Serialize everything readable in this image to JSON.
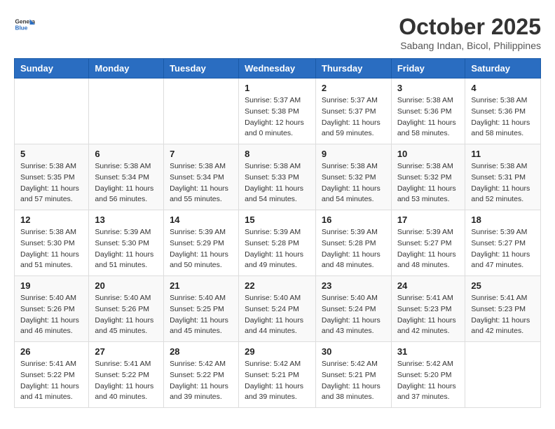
{
  "header": {
    "logo": "GeneralBlue",
    "month": "October 2025",
    "location": "Sabang Indan, Bicol, Philippines"
  },
  "weekdays": [
    "Sunday",
    "Monday",
    "Tuesday",
    "Wednesday",
    "Thursday",
    "Friday",
    "Saturday"
  ],
  "weeks": [
    [
      {
        "day": "",
        "info": ""
      },
      {
        "day": "",
        "info": ""
      },
      {
        "day": "",
        "info": ""
      },
      {
        "day": "1",
        "info": "Sunrise: 5:37 AM\nSunset: 5:38 PM\nDaylight: 12 hours\nand 0 minutes."
      },
      {
        "day": "2",
        "info": "Sunrise: 5:37 AM\nSunset: 5:37 PM\nDaylight: 11 hours\nand 59 minutes."
      },
      {
        "day": "3",
        "info": "Sunrise: 5:38 AM\nSunset: 5:36 PM\nDaylight: 11 hours\nand 58 minutes."
      },
      {
        "day": "4",
        "info": "Sunrise: 5:38 AM\nSunset: 5:36 PM\nDaylight: 11 hours\nand 58 minutes."
      }
    ],
    [
      {
        "day": "5",
        "info": "Sunrise: 5:38 AM\nSunset: 5:35 PM\nDaylight: 11 hours\nand 57 minutes."
      },
      {
        "day": "6",
        "info": "Sunrise: 5:38 AM\nSunset: 5:34 PM\nDaylight: 11 hours\nand 56 minutes."
      },
      {
        "day": "7",
        "info": "Sunrise: 5:38 AM\nSunset: 5:34 PM\nDaylight: 11 hours\nand 55 minutes."
      },
      {
        "day": "8",
        "info": "Sunrise: 5:38 AM\nSunset: 5:33 PM\nDaylight: 11 hours\nand 54 minutes."
      },
      {
        "day": "9",
        "info": "Sunrise: 5:38 AM\nSunset: 5:32 PM\nDaylight: 11 hours\nand 54 minutes."
      },
      {
        "day": "10",
        "info": "Sunrise: 5:38 AM\nSunset: 5:32 PM\nDaylight: 11 hours\nand 53 minutes."
      },
      {
        "day": "11",
        "info": "Sunrise: 5:38 AM\nSunset: 5:31 PM\nDaylight: 11 hours\nand 52 minutes."
      }
    ],
    [
      {
        "day": "12",
        "info": "Sunrise: 5:38 AM\nSunset: 5:30 PM\nDaylight: 11 hours\nand 51 minutes."
      },
      {
        "day": "13",
        "info": "Sunrise: 5:39 AM\nSunset: 5:30 PM\nDaylight: 11 hours\nand 51 minutes."
      },
      {
        "day": "14",
        "info": "Sunrise: 5:39 AM\nSunset: 5:29 PM\nDaylight: 11 hours\nand 50 minutes."
      },
      {
        "day": "15",
        "info": "Sunrise: 5:39 AM\nSunset: 5:28 PM\nDaylight: 11 hours\nand 49 minutes."
      },
      {
        "day": "16",
        "info": "Sunrise: 5:39 AM\nSunset: 5:28 PM\nDaylight: 11 hours\nand 48 minutes."
      },
      {
        "day": "17",
        "info": "Sunrise: 5:39 AM\nSunset: 5:27 PM\nDaylight: 11 hours\nand 48 minutes."
      },
      {
        "day": "18",
        "info": "Sunrise: 5:39 AM\nSunset: 5:27 PM\nDaylight: 11 hours\nand 47 minutes."
      }
    ],
    [
      {
        "day": "19",
        "info": "Sunrise: 5:40 AM\nSunset: 5:26 PM\nDaylight: 11 hours\nand 46 minutes."
      },
      {
        "day": "20",
        "info": "Sunrise: 5:40 AM\nSunset: 5:26 PM\nDaylight: 11 hours\nand 45 minutes."
      },
      {
        "day": "21",
        "info": "Sunrise: 5:40 AM\nSunset: 5:25 PM\nDaylight: 11 hours\nand 45 minutes."
      },
      {
        "day": "22",
        "info": "Sunrise: 5:40 AM\nSunset: 5:24 PM\nDaylight: 11 hours\nand 44 minutes."
      },
      {
        "day": "23",
        "info": "Sunrise: 5:40 AM\nSunset: 5:24 PM\nDaylight: 11 hours\nand 43 minutes."
      },
      {
        "day": "24",
        "info": "Sunrise: 5:41 AM\nSunset: 5:23 PM\nDaylight: 11 hours\nand 42 minutes."
      },
      {
        "day": "25",
        "info": "Sunrise: 5:41 AM\nSunset: 5:23 PM\nDaylight: 11 hours\nand 42 minutes."
      }
    ],
    [
      {
        "day": "26",
        "info": "Sunrise: 5:41 AM\nSunset: 5:22 PM\nDaylight: 11 hours\nand 41 minutes."
      },
      {
        "day": "27",
        "info": "Sunrise: 5:41 AM\nSunset: 5:22 PM\nDaylight: 11 hours\nand 40 minutes."
      },
      {
        "day": "28",
        "info": "Sunrise: 5:42 AM\nSunset: 5:22 PM\nDaylight: 11 hours\nand 39 minutes."
      },
      {
        "day": "29",
        "info": "Sunrise: 5:42 AM\nSunset: 5:21 PM\nDaylight: 11 hours\nand 39 minutes."
      },
      {
        "day": "30",
        "info": "Sunrise: 5:42 AM\nSunset: 5:21 PM\nDaylight: 11 hours\nand 38 minutes."
      },
      {
        "day": "31",
        "info": "Sunrise: 5:42 AM\nSunset: 5:20 PM\nDaylight: 11 hours\nand 37 minutes."
      },
      {
        "day": "",
        "info": ""
      }
    ]
  ]
}
